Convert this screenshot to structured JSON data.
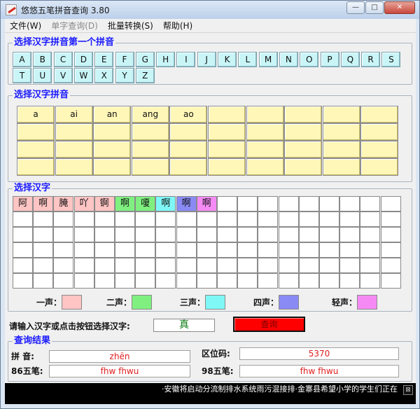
{
  "window": {
    "title": "悠悠五笔拼音查询 3.80",
    "minimize": "—",
    "maximize": "□",
    "close": "✕"
  },
  "menu": [
    {
      "label": "文件(W)",
      "disabled": false
    },
    {
      "label": "单字查询(D)",
      "disabled": true
    },
    {
      "label": "批量转换(S)",
      "disabled": false
    },
    {
      "label": "帮助(H)",
      "disabled": false
    }
  ],
  "letters_group": {
    "title": "选择汉字拼音第一个拼音",
    "letters": [
      "A",
      "B",
      "C",
      "D",
      "E",
      "F",
      "G",
      "H",
      "I",
      "J",
      "K",
      "L",
      "M",
      "N",
      "O",
      "P",
      "Q",
      "R",
      "S",
      "T",
      "U",
      "V",
      "W",
      "X",
      "Y",
      "Z"
    ]
  },
  "pinyin_group": {
    "title": "选择汉字拼音",
    "cells": [
      "a",
      "ai",
      "an",
      "ang",
      "ao",
      "",
      "",
      "",
      "",
      "",
      "",
      "",
      "",
      "",
      "",
      "",
      "",
      "",
      "",
      "",
      "",
      "",
      "",
      "",
      "",
      "",
      "",
      "",
      "",
      "",
      "",
      "",
      "",
      "",
      "",
      "",
      "",
      "",
      "",
      "",
      "",
      "",
      "",
      ""
    ]
  },
  "hanzi_group": {
    "title": "选择汉字",
    "chars": [
      {
        "c": "阿",
        "bg": "#ffc4c4"
      },
      {
        "c": "啊",
        "bg": "#ffc4c4"
      },
      {
        "c": "腌",
        "bg": "#ffc4c4"
      },
      {
        "c": "吖",
        "bg": "#ffc4c4"
      },
      {
        "c": "锕",
        "bg": "#ffc4c4"
      },
      {
        "c": "啊",
        "bg": "#7ff07f"
      },
      {
        "c": "嗄",
        "bg": "#7ff07f"
      },
      {
        "c": "啊",
        "bg": "#7ff7f7"
      },
      {
        "c": "啊",
        "bg": "#8a8af5"
      },
      {
        "c": "啊",
        "bg": "#f58af5"
      }
    ]
  },
  "tones": [
    {
      "label": "一声：",
      "color": "#ffc4c4"
    },
    {
      "label": "二声：",
      "color": "#7ff07f"
    },
    {
      "label": "三声：",
      "color": "#7ff7f7"
    },
    {
      "label": "四声：",
      "color": "#8a8af5"
    },
    {
      "label": "轻声：",
      "color": "#f58af5"
    }
  ],
  "input": {
    "label": "请输入汉字或点击按钮选择汉字:",
    "value": "真",
    "button": "查询"
  },
  "results": {
    "title": "查询结果",
    "pinyin_label": "拼  音:",
    "pinyin_value": "zhēn",
    "quweima_label": "区位码:",
    "quweima_value": "5370",
    "wubi86_label": "86五笔:",
    "wubi86_value": "fhw fhwu",
    "wubi98_label": "98五笔:",
    "wubi98_value": "fhw fhwu"
  },
  "status": {
    "marquee": "·安徽将启动分流制排水系统雨污混接排·金寨县希望小学的学生们正在",
    "corner": "⊠"
  }
}
